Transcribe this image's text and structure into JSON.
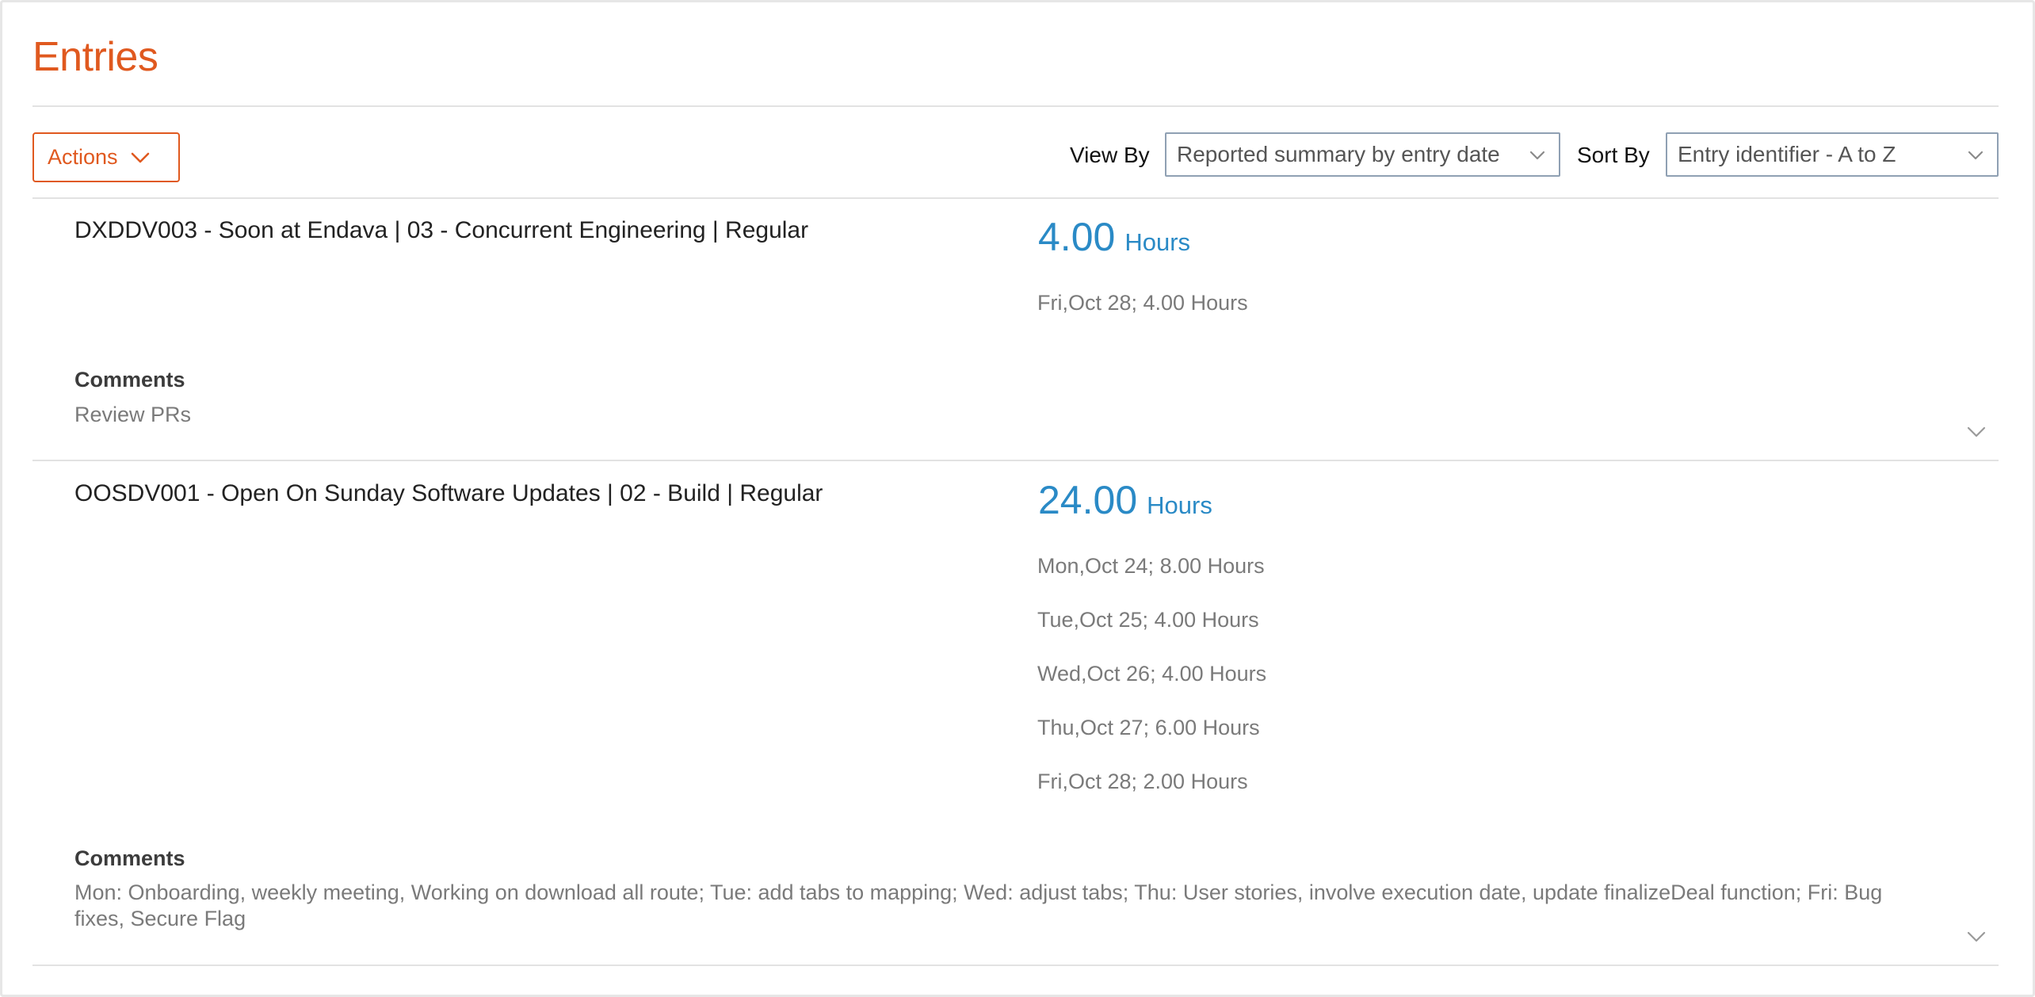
{
  "page": {
    "title": "Entries"
  },
  "toolbar": {
    "actions_label": "Actions",
    "view_by_label": "View By",
    "view_by_value": "Reported summary by entry date",
    "sort_by_label": "Sort By",
    "sort_by_value": "Entry identifier - A to Z"
  },
  "entries": [
    {
      "title": "DXDDV003 - Soon at Endava | 03 - Concurrent Engineering | Regular",
      "total_hours": "4.00",
      "hours_unit": "Hours",
      "days": [
        "Fri,Oct 28; 4.00 Hours"
      ],
      "comments_label": "Comments",
      "comments": "Review PRs"
    },
    {
      "title": "OOSDV001 - Open On Sunday Software Updates | 02 - Build | Regular",
      "total_hours": "24.00",
      "hours_unit": "Hours",
      "days": [
        "Mon,Oct 24; 8.00 Hours",
        "Tue,Oct 25; 4.00 Hours",
        "Wed,Oct 26; 4.00 Hours",
        "Thu,Oct 27; 6.00 Hours",
        "Fri,Oct 28; 2.00 Hours"
      ],
      "comments_label": "Comments",
      "comments": "Mon: Onboarding, weekly meeting, Working on download all route; Tue: add tabs to mapping; Wed: adjust tabs; Thu: User stories, involve execution date, update finalizeDeal function; Fri: Bug fixes, Secure Flag"
    }
  ],
  "icons": {
    "actions_chevron": "chevron-down-icon",
    "select_chevron": "chevron-down-icon",
    "expand_chevron": "chevron-down-icon"
  },
  "colors": {
    "accent": "#e0591f",
    "hours": "#2a8ac6",
    "muted_text": "#7a7a7a",
    "divider": "#e2e2e2"
  }
}
